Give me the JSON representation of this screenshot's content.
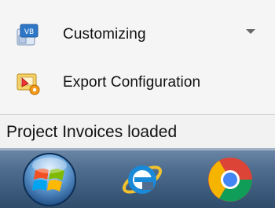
{
  "menu": {
    "items": [
      {
        "label": "Customizing",
        "icon": "vb-customize-icon",
        "has_dropdown": true
      },
      {
        "label": "Export Configuration",
        "icon": "export-config-icon",
        "has_dropdown": false
      }
    ]
  },
  "status": {
    "text": "Project Invoices loaded"
  },
  "taskbar": {
    "buttons": [
      {
        "icon": "windows-start-icon"
      },
      {
        "icon": "internet-explorer-icon"
      },
      {
        "icon": "chrome-icon"
      }
    ]
  },
  "colors": {
    "taskbar_top": "#6d89a8",
    "taskbar_bottom": "#2f4c6a",
    "text": "#111111"
  }
}
